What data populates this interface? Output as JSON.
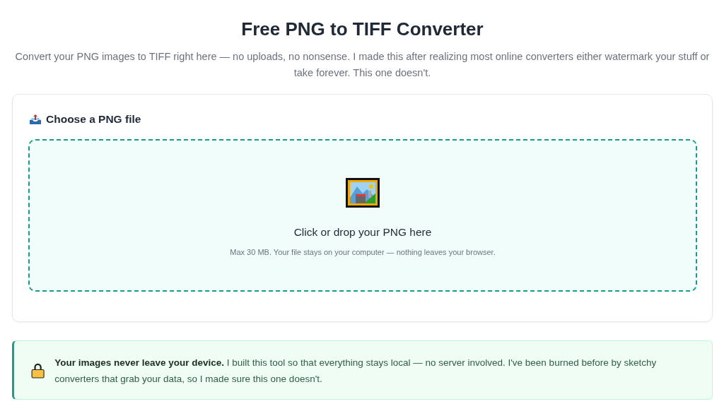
{
  "header": {
    "title": "Free PNG to TIFF Converter",
    "subtitle": "Convert your PNG images to TIFF right here — no uploads, no nonsense. I made this after realizing most online converters either watermark your stuff or take forever. This one doesn't."
  },
  "upload": {
    "label": "Choose a PNG file",
    "drop_text": "Click or drop your PNG here",
    "hint": "Max 30 MB. Your file stays on your computer — nothing leaves your browser."
  },
  "privacy_note": {
    "text": "**Your images never leave your device.** I built this tool so that everything stays local — no server involved. I've been burned before by sketchy converters that grab your data, so I made sure this one doesn't."
  }
}
